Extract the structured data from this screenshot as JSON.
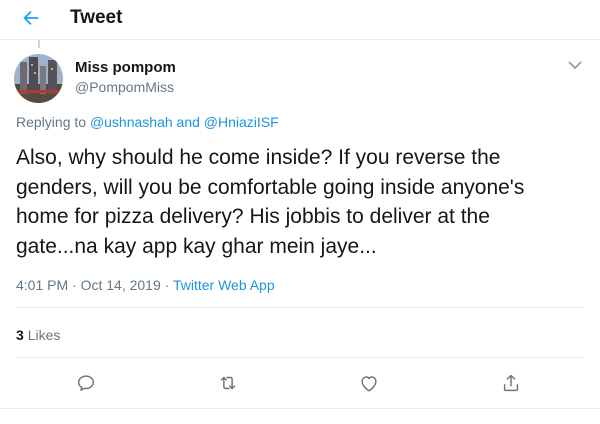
{
  "header": {
    "title": "Tweet",
    "back_icon": "arrow-left-icon",
    "accent": "#1da1f2"
  },
  "tweet": {
    "author_name": "Miss pompom",
    "author_handle": "@PompomMiss",
    "replying_prefix": "Replying to",
    "replying_user1": "@ushnashah",
    "replying_and": "and",
    "replying_user2": "@HniaziISF",
    "text_lines": [
      "Also, why should he come inside? If you reverse the",
      "genders, will you be comfortable going inside anyone's",
      "home for pizza delivery? His jobbis to deliver at the",
      "gate...na kay app kay ghar mein jaye..."
    ],
    "timestamp": "4:01 PM · Oct 14, 2019",
    "separator": "·",
    "source_app": "Twitter Web App",
    "likes_count": "3",
    "likes_label": "Likes"
  },
  "actions": [
    "reply-icon",
    "retweet-icon",
    "like-icon",
    "share-icon"
  ],
  "colors": {
    "link": "#1b95e0",
    "muted": "#657786",
    "text": "#14171a",
    "divider": "#e6ecf0"
  }
}
